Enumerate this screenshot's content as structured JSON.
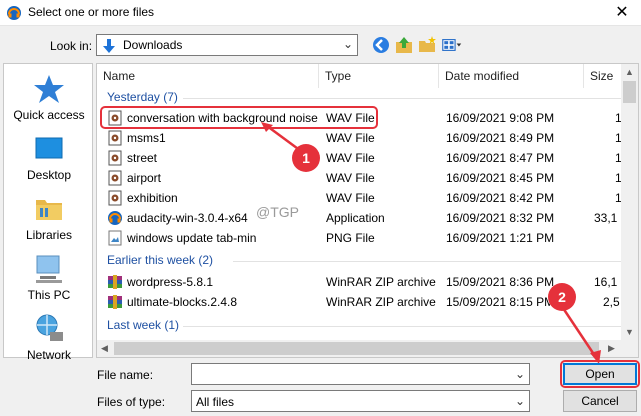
{
  "window": {
    "title": "Select one or more files",
    "close_glyph": "✕",
    "app_icon": "audacity-icon"
  },
  "toolbar": {
    "look_in_label": "Look in:",
    "look_in_value": "Downloads",
    "icons": [
      "back-icon",
      "up-folder-icon",
      "new-folder-icon",
      "view-menu-icon"
    ]
  },
  "places": [
    {
      "label": "Quick access",
      "icon": "star-icon"
    },
    {
      "label": "Desktop",
      "icon": "desktop-icon"
    },
    {
      "label": "Libraries",
      "icon": "libraries-icon"
    },
    {
      "label": "This PC",
      "icon": "computer-icon"
    },
    {
      "label": "Network",
      "icon": "network-icon"
    }
  ],
  "columns": {
    "name": "Name",
    "type": "Type",
    "date": "Date modified",
    "size": "Size"
  },
  "groups": [
    {
      "label": "Yesterday (7)"
    },
    {
      "label": "Earlier this week (2)"
    },
    {
      "label": "Last week (1)"
    }
  ],
  "files": [
    {
      "name": "conversation with background noise",
      "type": "WAV File",
      "date": "16/09/2021 9:08 PM",
      "size": "1",
      "icon": "audio-file-icon"
    },
    {
      "name": "msms1",
      "type": "WAV File",
      "date": "16/09/2021 8:49 PM",
      "size": "1",
      "icon": "audio-file-icon"
    },
    {
      "name": "street",
      "type": "WAV File",
      "date": "16/09/2021 8:47 PM",
      "size": "1",
      "icon": "audio-file-icon"
    },
    {
      "name": "airport",
      "type": "WAV File",
      "date": "16/09/2021 8:45 PM",
      "size": "1",
      "icon": "audio-file-icon"
    },
    {
      "name": "exhibition",
      "type": "WAV File",
      "date": "16/09/2021 8:42 PM",
      "size": "1",
      "icon": "audio-file-icon"
    },
    {
      "name": "audacity-win-3.0.4-x64",
      "type": "Application",
      "date": "16/09/2021 8:32 PM",
      "size": "33,1",
      "icon": "audacity-app-icon"
    },
    {
      "name": "windows update tab-min",
      "type": "PNG File",
      "date": "16/09/2021 1:21 PM",
      "size": "",
      "icon": "image-file-icon"
    },
    {
      "name": "wordpress-5.8.1",
      "type": "WinRAR ZIP archive",
      "date": "15/09/2021 8:36 PM",
      "size": "16,1",
      "icon": "winrar-icon"
    },
    {
      "name": "ultimate-blocks.2.4.8",
      "type": "WinRAR ZIP archive",
      "date": "15/09/2021 8:15 PM",
      "size": "2,5",
      "icon": "winrar-icon"
    }
  ],
  "filename": {
    "label": "File name:",
    "value": ""
  },
  "filetype": {
    "label": "Files of type:",
    "value": "All files"
  },
  "buttons": {
    "open": "Open",
    "cancel": "Cancel"
  },
  "annotations": {
    "badge1": "1",
    "badge2": "2",
    "accent": "#e5313b"
  },
  "watermark": "@TGP"
}
